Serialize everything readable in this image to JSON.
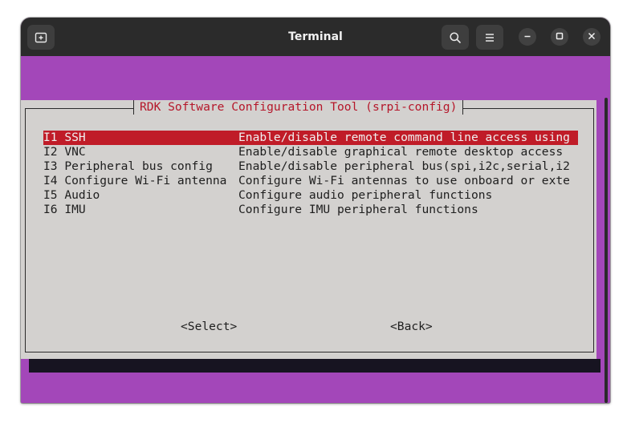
{
  "window": {
    "title": "Terminal"
  },
  "header_icons": {
    "new_tab": "new-tab-icon",
    "search": "search-icon",
    "menu": "hamburger-menu-icon",
    "minimize": "minimize-icon",
    "maximize": "maximize-icon",
    "close": "close-icon"
  },
  "colors": {
    "terminal_background": "#a347b9",
    "dialog_background": "#d3d1cf",
    "selection": "#c01c28",
    "title_text": "#b5162a"
  },
  "dialog": {
    "title": "RDK Software Configuration Tool (srpi-config)",
    "items": [
      {
        "key": "I1 SSH",
        "description": "Enable/disable remote command line access using",
        "selected": true
      },
      {
        "key": "I2 VNC",
        "description": "Enable/disable graphical remote desktop access",
        "selected": false
      },
      {
        "key": "I3 Peripheral bus config",
        "description": "Enable/disable peripheral bus(spi,i2c,serial,i2",
        "selected": false
      },
      {
        "key": "I4 Configure Wi-Fi antenna",
        "description": "Configure Wi-Fi antennas to use onboard or exte",
        "selected": false
      },
      {
        "key": "I5 Audio",
        "description": "Configure audio peripheral functions",
        "selected": false
      },
      {
        "key": "I6 IMU",
        "description": "Configure IMU peripheral functions",
        "selected": false
      }
    ],
    "select_button": "<Select>",
    "back_button": "<Back>"
  }
}
